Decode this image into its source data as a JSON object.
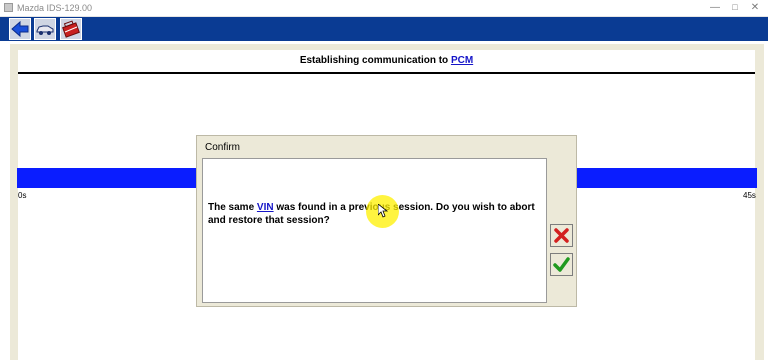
{
  "window": {
    "title": "Mazda IDS-129.00"
  },
  "toolbar": {
    "buttons": [
      "back-arrow-icon",
      "vehicle-icon",
      "toolbox-icon"
    ]
  },
  "screen": {
    "header_prefix": "Establishing communication to ",
    "header_link": "PCM",
    "progress_start_label": "0s",
    "progress_end_label": "45s"
  },
  "dialog": {
    "title": "Confirm",
    "message_before_link": "The same ",
    "message_link": "VIN",
    "message_after_link": " was found in a previous session.  Do you wish to abort and restore that session?",
    "abort_button": "x-icon",
    "confirm_button": "checkmark-icon"
  },
  "colors": {
    "toolbar": "#0a3b93",
    "progress": "#0a1dff",
    "panel": "#ece9d8",
    "link": "#1515c8",
    "abort": "#d32020",
    "confirm": "#1f9a1f"
  }
}
